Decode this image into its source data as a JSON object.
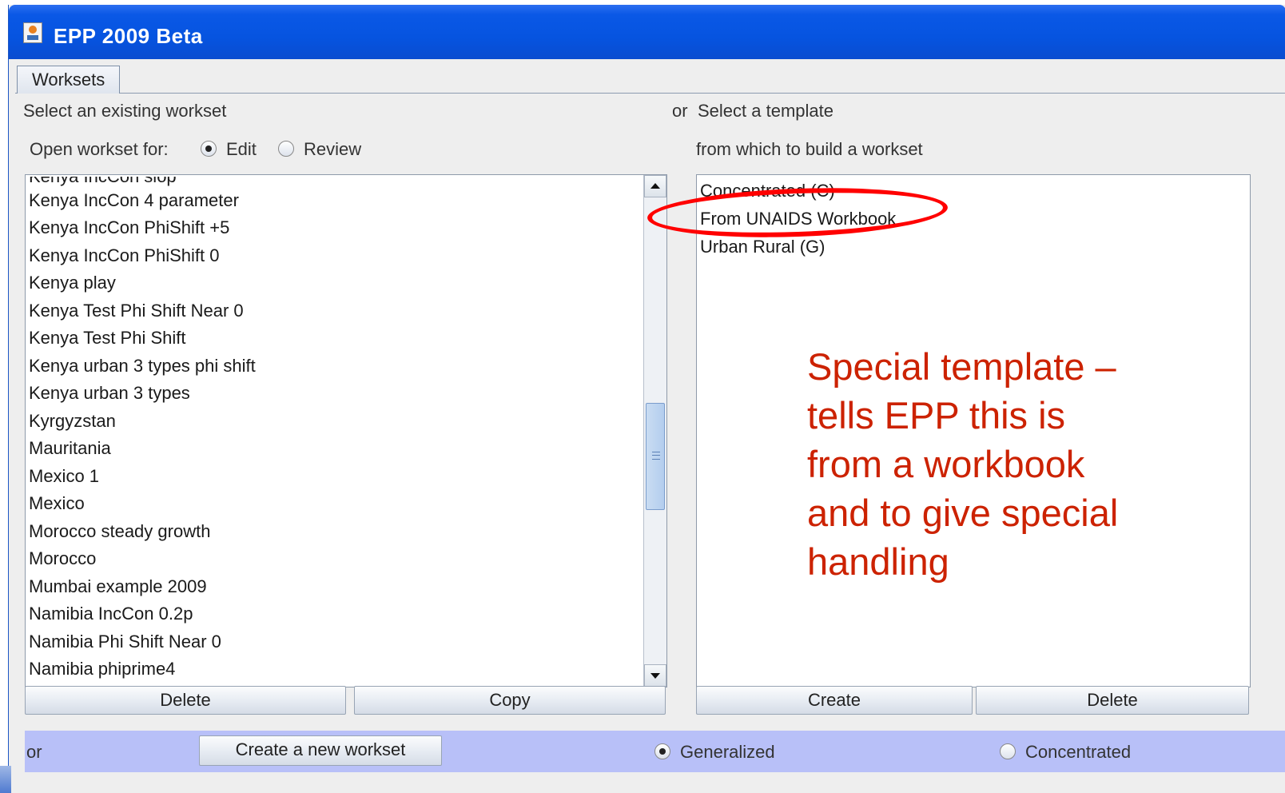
{
  "window": {
    "title": "EPP 2009 Beta"
  },
  "tabs": [
    {
      "label": "Worksets"
    }
  ],
  "left": {
    "heading": "Select an existing workset",
    "open_for_label": "Open workset for:",
    "open_for_options": [
      {
        "label": "Edit",
        "selected": true
      },
      {
        "label": "Review",
        "selected": false
      }
    ],
    "partial_top_item": "Kenya IncCon slop",
    "items": [
      "Kenya IncCon 4 parameter",
      "Kenya IncCon PhiShift +5",
      "Kenya IncCon PhiShift 0",
      "Kenya play",
      "Kenya Test Phi Shift Near 0",
      "Kenya Test Phi Shift",
      "Kenya urban 3 types phi shift",
      "Kenya urban 3 types",
      "Kyrgyzstan",
      "Mauritania",
      "Mexico 1",
      "Mexico",
      "Morocco steady growth",
      "Morocco",
      "Mumbai example 2009",
      "Namibia IncCon 0.2p",
      "Namibia Phi Shift Near 0",
      "Namibia phiprime4"
    ],
    "buttons": {
      "delete": "Delete",
      "copy": "Copy"
    }
  },
  "right": {
    "or_label": "or",
    "heading": "Select a template",
    "subheading": "from which to build a workset",
    "templates": [
      "Concentrated (C)",
      "From UNAIDS Workbook",
      "Urban Rural (G)"
    ],
    "buttons": {
      "create": "Create",
      "delete": "Delete"
    }
  },
  "bottom": {
    "or_label": "or",
    "create_button": "Create a new workset",
    "epidemic_options": [
      {
        "label": "Generalized",
        "selected": true
      },
      {
        "label": "Concentrated",
        "selected": false
      }
    ]
  },
  "annotation": {
    "text_lines": [
      "Special template –",
      "tells EPP this is",
      "from a workbook",
      "and to give special",
      "handling"
    ],
    "callout_color": "#ff0000",
    "text_color": "#cc2200"
  },
  "colors": {
    "titlebar": "#0654e0",
    "bottom_bar": "#b8c0f8",
    "panel": "#eeeeee"
  }
}
